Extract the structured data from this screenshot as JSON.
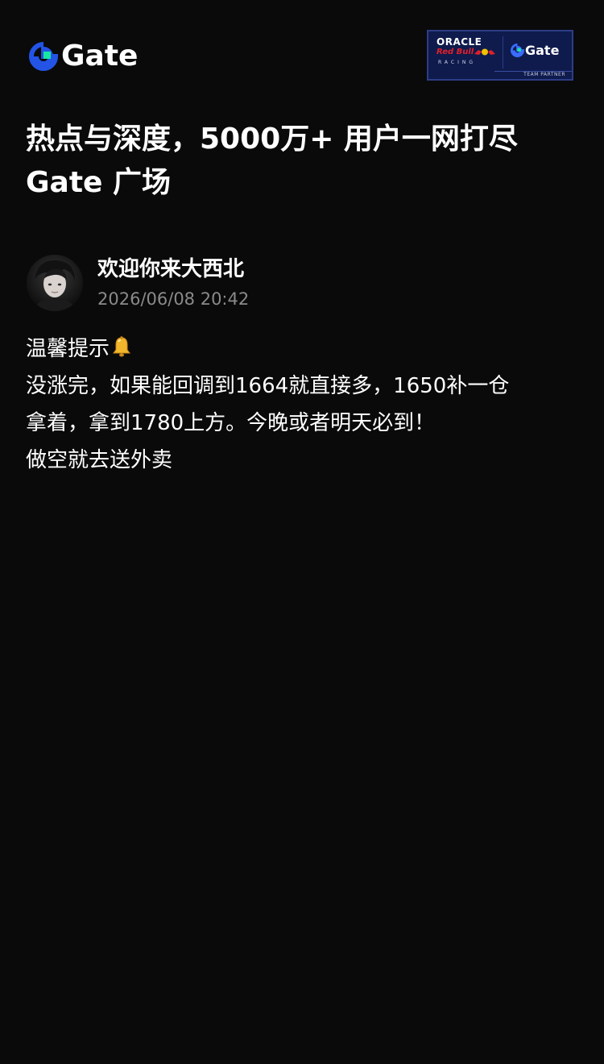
{
  "header": {
    "logo_text": "Gate",
    "logo_icon": "gate-logo-icon",
    "partner": {
      "oracle": "ORACLE",
      "red_bull": "Red Bull",
      "racing": "RACING",
      "gate": "Gate",
      "team_partner": "TEAM PARTNER"
    }
  },
  "headline": {
    "line1": "热点与深度，5000万+ 用户一网打尽",
    "line2": "Gate 广场"
  },
  "post": {
    "author_name": "欢迎你来大西北",
    "timestamp": "2026/06/08 20:42",
    "avatar": "avatar",
    "lines": [
      "温馨提示",
      "没涨完，如果能回调到1664就直接多，1650补一仓",
      "拿着，拿到1780上方。今晚或者明天必到！",
      "做空就去送外卖"
    ],
    "emoji": "bell-icon"
  },
  "colors": {
    "background": "#0a0a0a",
    "brand_blue": "#2354e6",
    "brand_green": "#17e6a1",
    "muted_text": "#8a8a8a",
    "badge_bg": "#0f1b4d"
  }
}
